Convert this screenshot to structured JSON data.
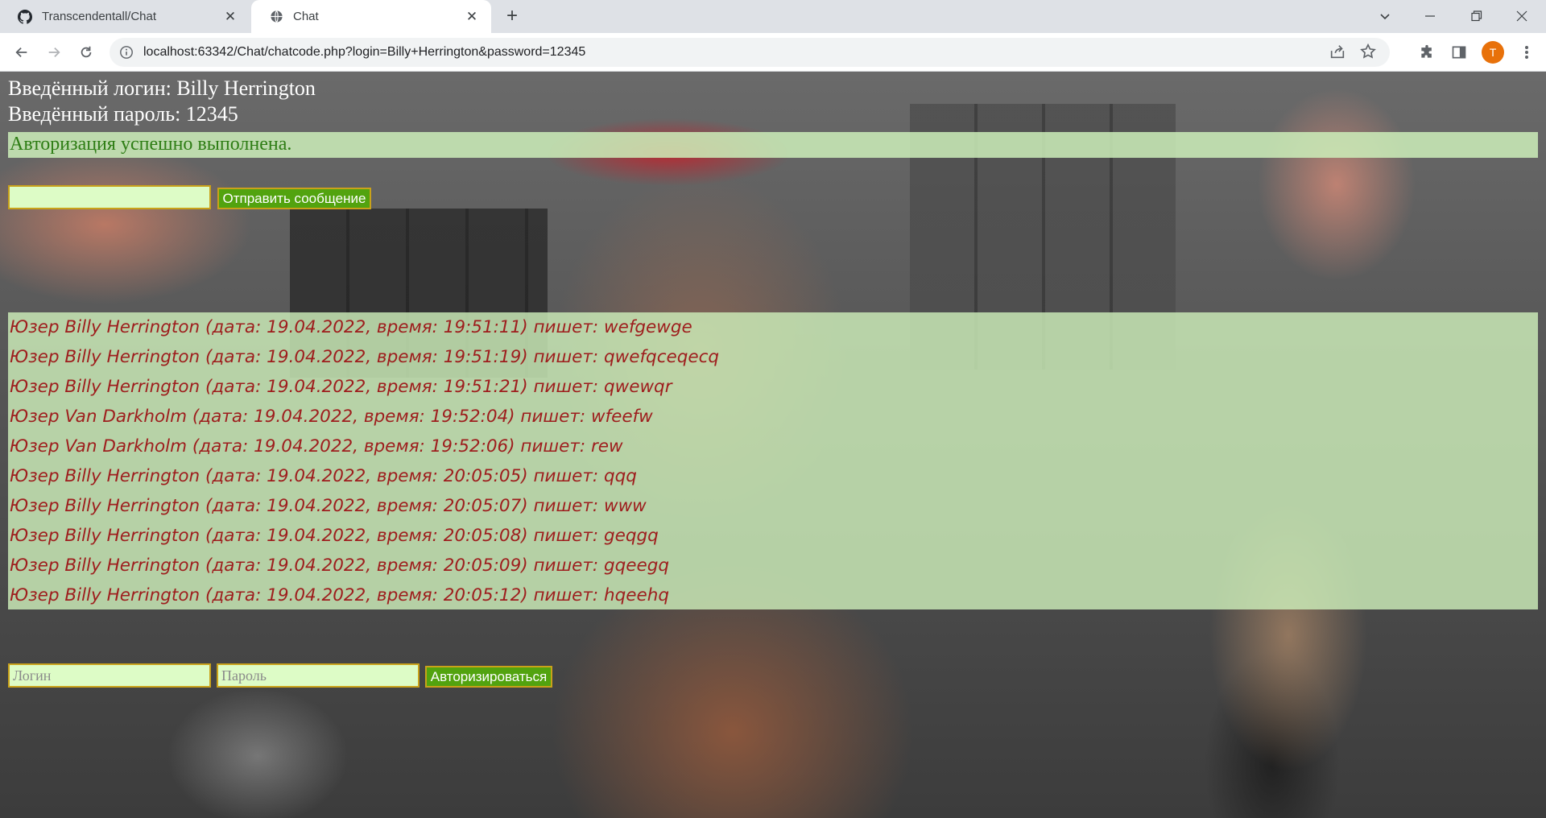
{
  "browser": {
    "tabs": [
      {
        "title": "Transcendentall/Chat",
        "favicon": "github-icon",
        "active": false
      },
      {
        "title": "Chat",
        "favicon": "globe-icon",
        "active": true
      }
    ],
    "address": "localhost:63342/Chat/chatcode.php?login=Billy+Herrington&password=12345",
    "profile_initial": "T"
  },
  "page": {
    "login_line": "Введённый логин: Billy Herrington",
    "password_line": "Введённый пароль: 12345",
    "auth_status": "Авторизация успешно выполнена.",
    "message_input_value": "",
    "send_button": "Отправить сообщение",
    "messages": [
      "Юзер Billy Herrington (дата: 19.04.2022, время: 19:51:11) пишет: wefgewge",
      "Юзер Billy Herrington (дата: 19.04.2022, время: 19:51:19) пишет: qwefqceqecq",
      "Юзер Billy Herrington (дата: 19.04.2022, время: 19:51:21) пишет: qwewqr",
      "Юзер Van Darkholm (дата: 19.04.2022, время: 19:52:04) пишет: wfeefw",
      "Юзер Van Darkholm (дата: 19.04.2022, время: 19:52:06) пишет: rew",
      "Юзер Billy Herrington (дата: 19.04.2022, время: 20:05:05) пишет: qqq",
      "Юзер Billy Herrington (дата: 19.04.2022, время: 20:05:07) пишет: www",
      "Юзер Billy Herrington (дата: 19.04.2022, время: 20:05:08) пишет: geqgq",
      "Юзер Billy Herrington (дата: 19.04.2022, время: 20:05:09) пишет: gqeegq",
      "Юзер Billy Herrington (дата: 19.04.2022, время: 20:05:12) пишет: hqeehq"
    ],
    "login_placeholder": "Логин",
    "password_placeholder": "Пароль",
    "auth_button": "Авторизироваться"
  },
  "colors": {
    "banner_bg": "#cdeeba",
    "status_text": "#2e7d15",
    "message_text": "#9e1d1d",
    "button_bg": "#52a30f",
    "input_bg": "#ddfcc6",
    "input_border": "#c9a21a"
  }
}
